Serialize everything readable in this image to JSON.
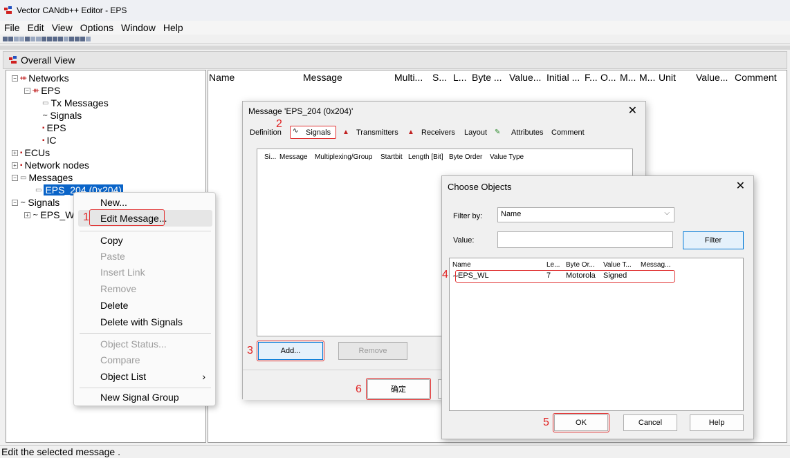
{
  "window": {
    "title": "Vector CANdb++ Editor - EPS"
  },
  "menu": [
    "File",
    "Edit",
    "View",
    "Options",
    "Window",
    "Help"
  ],
  "overall_view": {
    "title": "Overall View"
  },
  "tree": {
    "networks": "Networks",
    "eps_network": "EPS",
    "tx_messages": "Tx Messages",
    "signals_child": "Signals",
    "eps_node": "EPS",
    "ic_node": "IC",
    "ecus": "ECUs",
    "network_nodes": "Network nodes",
    "messages": "Messages",
    "message_item": "EPS_204 (0x204)",
    "signals": "Signals",
    "signal_item": "EPS_W"
  },
  "list_columns": [
    "Name",
    "Message",
    "Multi...",
    "S...",
    "L...",
    "Byte ...",
    "Value...",
    "Initial ...",
    "F...",
    "O...",
    "M...",
    "M...",
    "Unit",
    "Value...",
    "Comment"
  ],
  "context_menu": {
    "new": "New...",
    "edit": "Edit Message...",
    "copy": "Copy",
    "paste": "Paste",
    "insert_link": "Insert Link",
    "remove": "Remove",
    "delete": "Delete",
    "delete_signals": "Delete with Signals",
    "object_status": "Object Status...",
    "compare": "Compare",
    "object_list": "Object List",
    "new_signal_group": "New Signal Group"
  },
  "message_dialog": {
    "title": "Message 'EPS_204 (0x204)'",
    "tabs": [
      "Definition",
      "Signals",
      "Transmitters",
      "Receivers",
      "Layout",
      "Attributes",
      "Comment"
    ],
    "columns": [
      "Si...",
      "Message",
      "Multiplexing/Group",
      "Startbit",
      "Length [Bit]",
      "Byte Order",
      "Value Type"
    ],
    "add_label": "Add...",
    "remove_label": "Remove",
    "ok_label": "确定"
  },
  "choose_dialog": {
    "title": "Choose Objects",
    "filter_by_label": "Filter by:",
    "filter_by_value": "Name",
    "value_label": "Value:",
    "filter_button": "Filter",
    "columns": [
      "Name",
      "Le...",
      "Byte Or...",
      "Value T...",
      "Messag..."
    ],
    "row": {
      "name": "EPS_WL",
      "length": "7",
      "byte_order": "Motorola",
      "value_type": "Signed"
    },
    "ok_label": "OK",
    "cancel_label": "Cancel",
    "help_label": "Help"
  },
  "steps": [
    "1",
    "2",
    "3",
    "4",
    "5",
    "6"
  ],
  "status": "Edit the selected message .",
  "colors": {
    "selection": "#0a64c8",
    "highlight_box": "#e03030",
    "accent": "#0078d7"
  }
}
